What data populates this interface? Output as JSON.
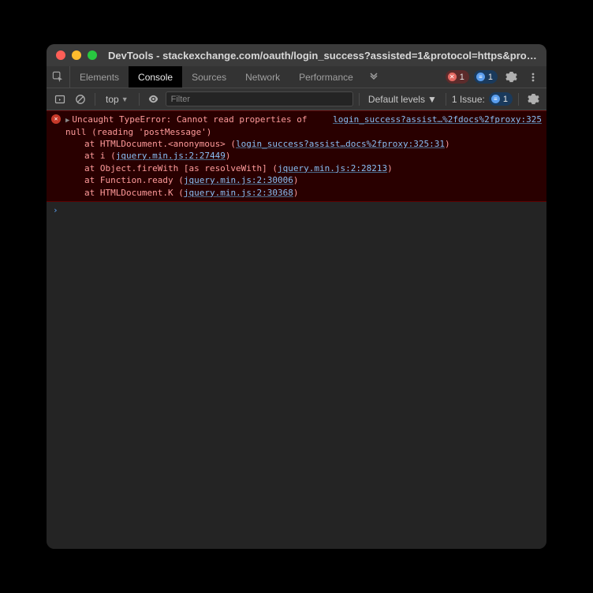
{
  "window": {
    "title": "DevTools - stackexchange.com/oauth/login_success?assisted=1&protocol=https&prox…"
  },
  "tabs": {
    "items": [
      "Elements",
      "Console",
      "Sources",
      "Network",
      "Performance"
    ],
    "active": "Console"
  },
  "indicators": {
    "errors": "1",
    "issues_badge": "1",
    "issue_text": "1 Issue:",
    "issue_count": "1"
  },
  "toolbar": {
    "context": "top",
    "filter_placeholder": "Filter",
    "levels": "Default levels"
  },
  "error": {
    "message_line1": "Uncaught TypeError: Cannot read properties of ",
    "message_line2": "null (reading 'postMessage')",
    "source": "login_success?assist…%2fdocs%2fproxy:325",
    "stack": [
      {
        "prefix": "at HTMLDocument.<anonymous> (",
        "link": "login_success?assist…docs%2fproxy:325:31",
        "suffix": ")"
      },
      {
        "prefix": "at i (",
        "link": "jquery.min.js:2:27449",
        "suffix": ")"
      },
      {
        "prefix": "at Object.fireWith [as resolveWith] (",
        "link": "jquery.min.js:2:28213",
        "suffix": ")"
      },
      {
        "prefix": "at Function.ready (",
        "link": "jquery.min.js:2:30006",
        "suffix": ")"
      },
      {
        "prefix": "at HTMLDocument.K (",
        "link": "jquery.min.js:2:30368",
        "suffix": ")"
      }
    ]
  },
  "prompt": "›"
}
